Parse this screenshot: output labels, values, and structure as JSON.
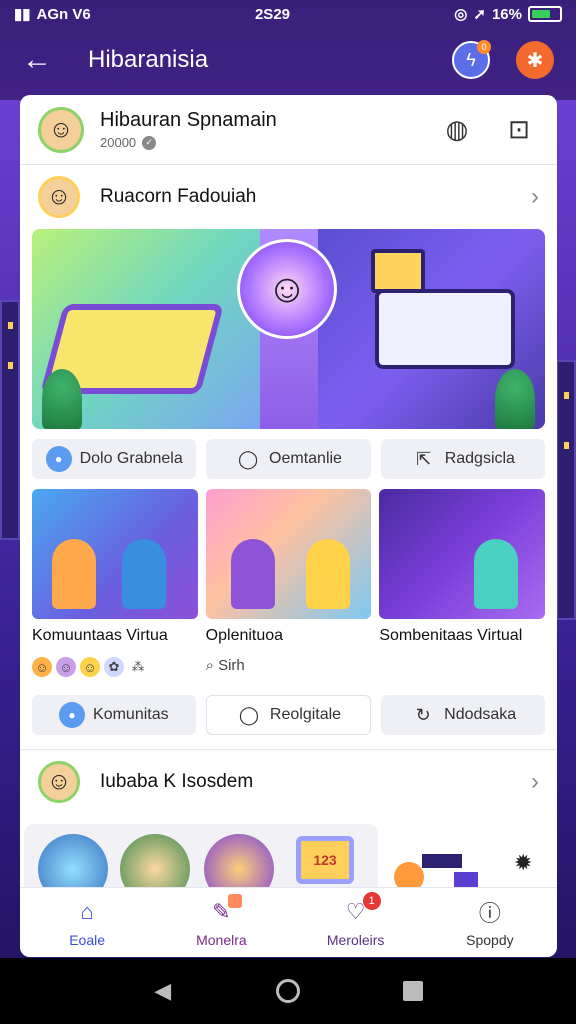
{
  "status_bar": {
    "carrier": "AGn V6",
    "time": "2S29",
    "battery_pct": "16%",
    "battery_level": 0.7
  },
  "header": {
    "title": "Hibaranisia",
    "notification_badge": "0"
  },
  "profile": {
    "name": "Hibauran Spnamain",
    "subtitle": "20000"
  },
  "section1": {
    "title": "Ruacorn Fadouiah"
  },
  "chips_row1": [
    {
      "label": "Dolo Grabnela",
      "icon": "community-icon"
    },
    {
      "label": "Oemtanlie",
      "icon": "comment-icon"
    },
    {
      "label": "Radgsicla",
      "icon": "share-icon"
    }
  ],
  "tiles": [
    {
      "title": "Komuuntaas Virtua"
    },
    {
      "title": "Oplenituoa",
      "meta": "Sirh"
    },
    {
      "title": "Sombenitaas Virtual"
    }
  ],
  "chips_row2": [
    {
      "label": "Komunitas",
      "icon": "community-icon"
    },
    {
      "label": "Reolgitale",
      "icon": "comment-icon"
    },
    {
      "label": "Ndodsaka",
      "icon": "refresh-icon"
    }
  ],
  "section2": {
    "title": "Iubaba K Isosdem"
  },
  "gallery": {
    "tv_text": "123"
  },
  "bottom_nav": [
    {
      "label": "Eoale",
      "icon": "home-icon"
    },
    {
      "label": "Monelra",
      "icon": "edit-icon"
    },
    {
      "label": "Meroleirs",
      "icon": "chat-icon",
      "badge": "1"
    },
    {
      "label": "Spopdy",
      "icon": "info-icon"
    }
  ],
  "colors": {
    "accent": "#3a4fd8",
    "bg_top": "#3a1f7a",
    "profile_btn": "#f26a2e",
    "badge_red": "#e53935"
  }
}
